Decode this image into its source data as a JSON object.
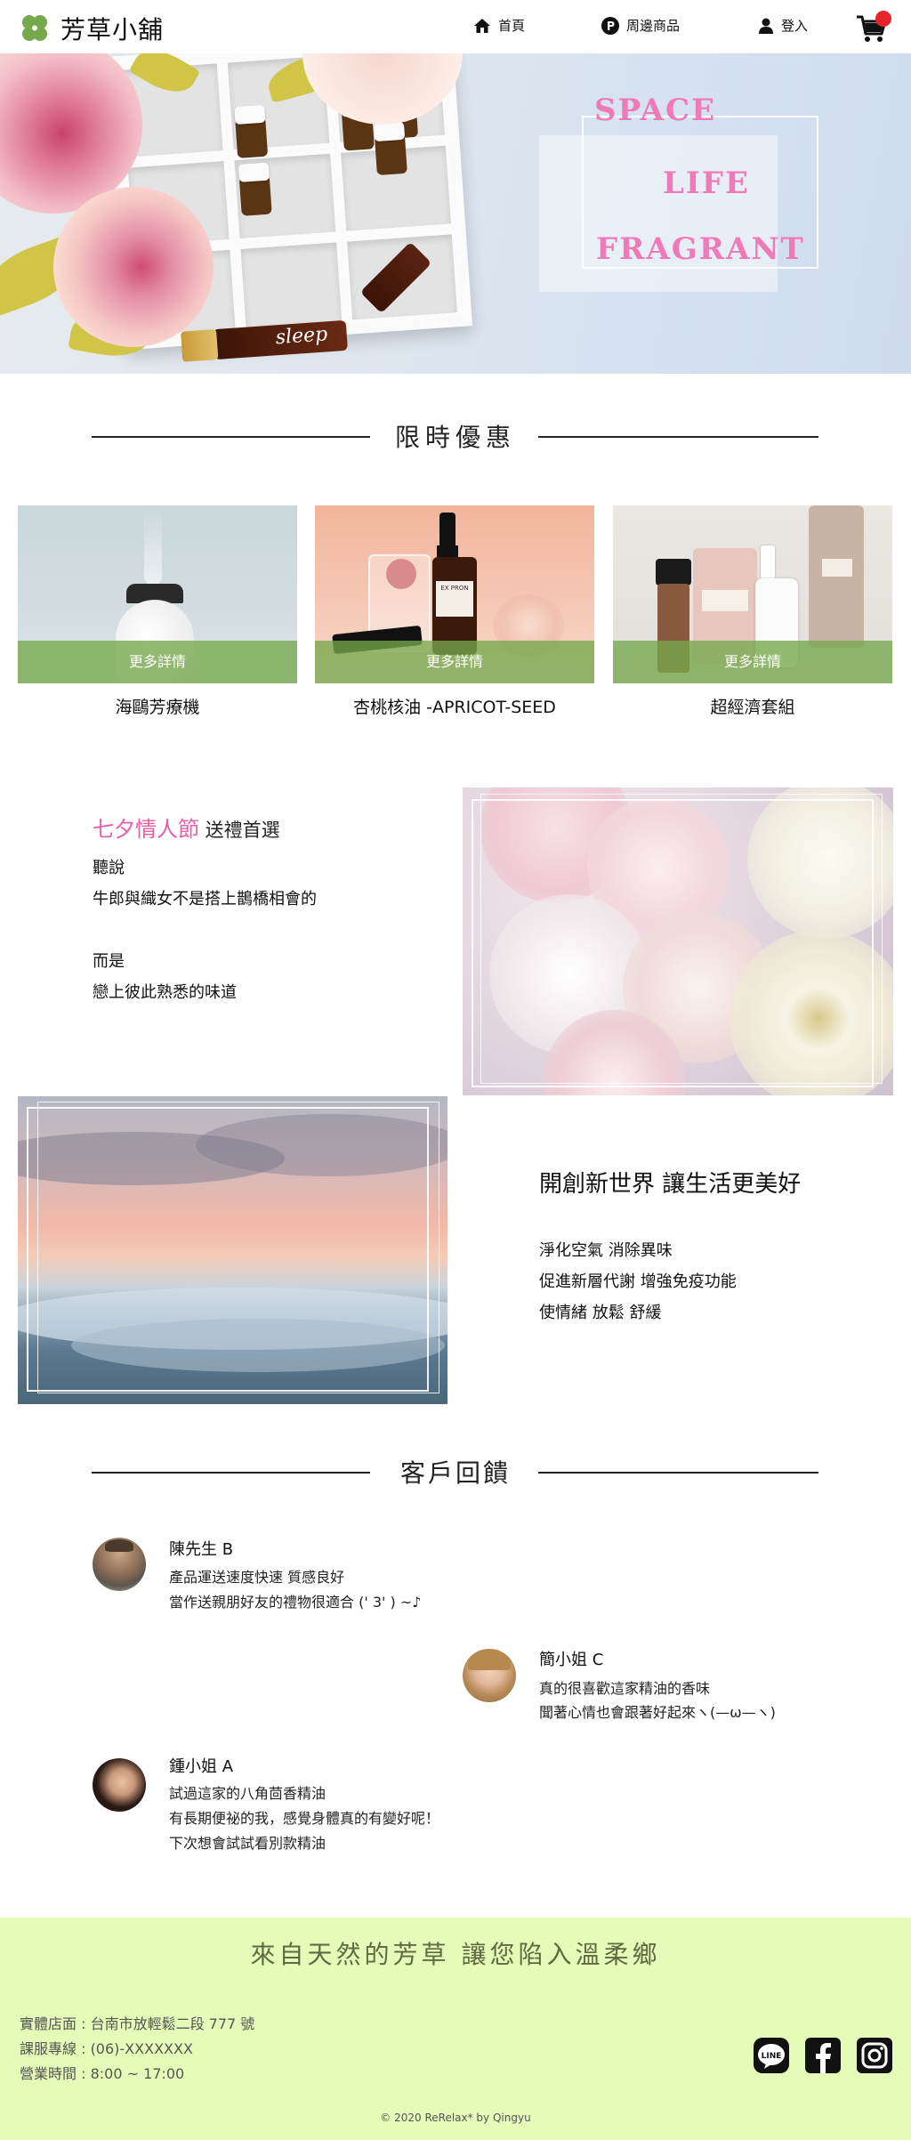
{
  "nav": {
    "brand": "芳草小舖",
    "logo_icon": "four-leaf-clover-icon",
    "home_label": "首頁",
    "home_icon": "home-icon",
    "merch_label": "周邊商品",
    "merch_icon": "p-circle-icon",
    "login_label": "登入",
    "login_icon": "user-icon",
    "cart_icon": "shopping-cart-icon",
    "accent_color": "#76a84c",
    "cart_badge_color": "#e8232b"
  },
  "hero": {
    "words": [
      "SPACE",
      "LIFE",
      "FRAGRANT"
    ],
    "bottle_label": "sleep",
    "word_color": "#f07ab8"
  },
  "deals": {
    "title": "限時優惠",
    "items": [
      {
        "name": "海鷗芳療機",
        "more_label": "更多詳情"
      },
      {
        "name": "杏桃核油 -APRICOT-SEED",
        "more_label": "更多詳情"
      },
      {
        "name": "超經濟套組",
        "more_label": "更多詳情"
      }
    ],
    "item2_bottle_label": "EX PRON"
  },
  "feature1": {
    "title_highlight": "七夕情人節",
    "title_rest": " 送禮首選",
    "lines": [
      "聽說",
      "牛郎與織女不是搭上鵲橋相會的",
      "",
      "而是",
      "戀上彼此熟悉的味道"
    ]
  },
  "feature2": {
    "title": "開創新世界 讓生活更美好",
    "lines": [
      "淨化空氣 消除異味",
      "促進新層代謝 增強免疫功能",
      "使情緒 放鬆 舒緩"
    ]
  },
  "reviews": {
    "title": "客戶回饋",
    "items": [
      {
        "name": "陳先生 B",
        "lines": [
          "產品運送速度快速 質感良好",
          "當作送親朋好友的禮物很適合 (' 3' ) ~♪"
        ]
      },
      {
        "name": "簡小姐 C",
        "lines": [
          "真的很喜歡這家精油的香味",
          "聞著心情也會跟著好起來ヽ(—ω—ヽ)"
        ]
      },
      {
        "name": "鍾小姐 A",
        "lines": [
          "試過這家的八角茴香精油",
          "有長期便祕的我，感覺身體真的有變好呢！",
          "下次想會試試看別款精油"
        ]
      }
    ]
  },
  "footer": {
    "slogan": "來自天然的芳草 讓您陷入溫柔鄉",
    "address": "實體店面 : 台南市放輕鬆二段 777 號",
    "phone": "課服專線 : (06)-XXXXXXX",
    "hours": "營業時間 : 8:00 ~ 17:00",
    "copyright": "© 2020 ReRelax* by Qingyu",
    "social_icons": [
      "line-icon",
      "facebook-icon",
      "instagram-icon"
    ],
    "background": "#e4fcb8"
  }
}
